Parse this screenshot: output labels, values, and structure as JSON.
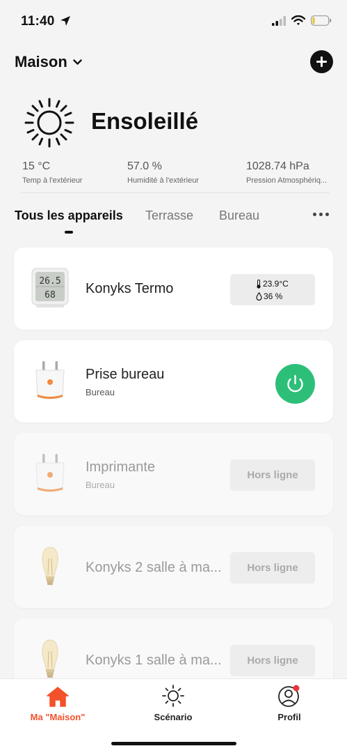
{
  "status_bar": {
    "time": "11:40"
  },
  "header": {
    "home_name": "Maison"
  },
  "weather": {
    "condition": "Ensoleillé",
    "stats": [
      {
        "value": "15 °C",
        "label": "Temp à l'extérieur"
      },
      {
        "value": "57.0 %",
        "label": "Humidité à l'extérieur"
      },
      {
        "value": "1028.74 hPa",
        "label": "Pression Atmosphériq..."
      }
    ]
  },
  "tabs": [
    {
      "label": "Tous les appareils",
      "active": true
    },
    {
      "label": "Terrasse",
      "active": false
    },
    {
      "label": "Bureau",
      "active": false
    }
  ],
  "devices": [
    {
      "name": "Konyks Termo",
      "room": "",
      "type": "thermometer",
      "temperature": "23.9°C",
      "humidity": "36 %",
      "screen_top": "26.5",
      "screen_bottom": "68"
    },
    {
      "name": "Prise bureau",
      "room": "Bureau",
      "type": "plug",
      "state": "online"
    },
    {
      "name": "Imprimante",
      "room": "Bureau",
      "type": "plug",
      "state": "offline",
      "status": "Hors ligne"
    },
    {
      "name": "Konyks 2 salle à ma...",
      "room": "",
      "type": "bulb",
      "state": "offline",
      "status": "Hors ligne"
    },
    {
      "name": "Konyks 1 salle à ma...",
      "room": "",
      "type": "bulb",
      "state": "offline",
      "status": "Hors ligne"
    }
  ],
  "nav": [
    {
      "label": "Ma \"Maison\"",
      "icon": "home-icon",
      "active": true
    },
    {
      "label": "Scénario",
      "icon": "sun-icon",
      "active": false
    },
    {
      "label": "Profil",
      "icon": "profile-icon",
      "active": false,
      "badge": true
    }
  ],
  "colors": {
    "accent": "#f3512a",
    "power_on": "#2dbf78",
    "badge": "#e8343a",
    "background": "#f4f4f4"
  }
}
